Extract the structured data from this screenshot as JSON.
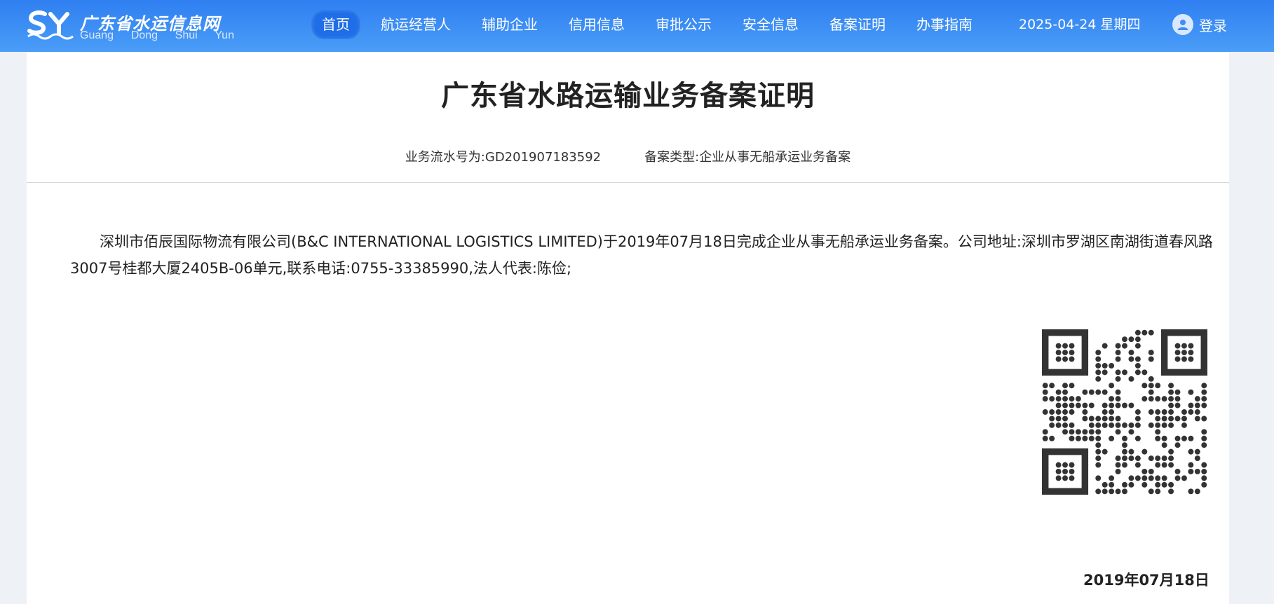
{
  "header": {
    "logo_title": "广东省水运信息网",
    "logo_sub": [
      "Guang",
      "Dong",
      "Shui",
      "Yun"
    ],
    "nav": [
      {
        "label": "首页",
        "active": true
      },
      {
        "label": "航运经营人",
        "active": false
      },
      {
        "label": "辅助企业",
        "active": false
      },
      {
        "label": "信用信息",
        "active": false
      },
      {
        "label": "审批公示",
        "active": false
      },
      {
        "label": "安全信息",
        "active": false
      },
      {
        "label": "备案证明",
        "active": false
      },
      {
        "label": "办事指南",
        "active": false
      }
    ],
    "date": "2025-04-24 星期四",
    "login_label": "登录",
    "login_icon": "user-icon"
  },
  "certificate": {
    "title": "广东省水路运输业务备案证明",
    "serial_label": "业务流水号为:",
    "serial_value": "GD201907183592",
    "type_label": "备案类型:",
    "type_value": "企业从事无船承运业务备案",
    "body": "深圳市佰辰国际物流有限公司(B&C INTERNATIONAL LOGISTICS LIMITED)于2019年07月18日完成企业从事无船承运业务备案。公司地址:深圳市罗湖区南湖街道春风路3007号桂都大厦2405B-06单元,联系电话:0755-33385990,法人代表:陈俭;",
    "qr_icon": "qr-code",
    "date": "2019年07月18日"
  },
  "colors": {
    "header_top": "#2f7ff1",
    "header_bottom": "#4a9df7",
    "nav_active": "#1f6ee8",
    "page_bg": "#eef1f6",
    "card_bg": "#ffffff"
  }
}
